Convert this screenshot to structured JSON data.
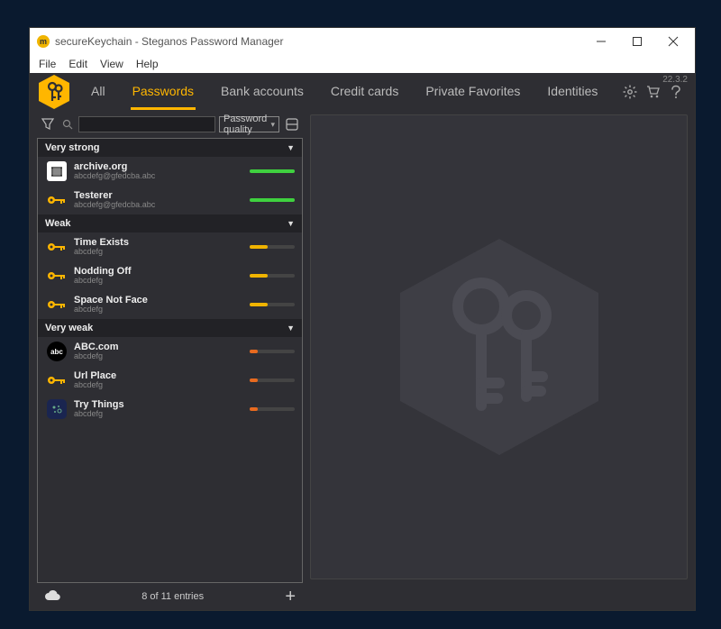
{
  "window": {
    "title": "secureKeychain - Steganos Password Manager"
  },
  "menu": {
    "file": "File",
    "edit": "Edit",
    "view": "View",
    "help": "Help"
  },
  "version": "22.3.2",
  "tabs": {
    "all": "All",
    "passwords": "Passwords",
    "bank": "Bank accounts",
    "credit": "Credit cards",
    "fav": "Private Favorites",
    "ident": "Identities"
  },
  "filter": {
    "search_placeholder": "",
    "sort_label": "Password quality"
  },
  "groups": [
    {
      "label": "Very strong",
      "strength": "green",
      "items": [
        {
          "title": "archive.org",
          "sub": "abcdefg@gfedcba.abc",
          "icon": "archive"
        },
        {
          "title": "Testerer",
          "sub": "abcdefg@gfedcba.abc",
          "icon": "key"
        }
      ]
    },
    {
      "label": "Weak",
      "strength": "yellow",
      "items": [
        {
          "title": "Time Exists",
          "sub": "abcdefg",
          "icon": "key"
        },
        {
          "title": "Nodding Off",
          "sub": "abcdefg",
          "icon": "key"
        },
        {
          "title": "Space Not Face",
          "sub": "abcdefg",
          "icon": "key"
        }
      ]
    },
    {
      "label": "Very weak",
      "strength": "orange",
      "items": [
        {
          "title": "ABC.com",
          "sub": "abcdefg",
          "icon": "abc"
        },
        {
          "title": "Url Place",
          "sub": "abcdefg",
          "icon": "key"
        },
        {
          "title": "Try Things",
          "sub": "abcdefg",
          "icon": "dots"
        }
      ]
    }
  ],
  "status": {
    "count_text": "8 of 11 entries"
  }
}
